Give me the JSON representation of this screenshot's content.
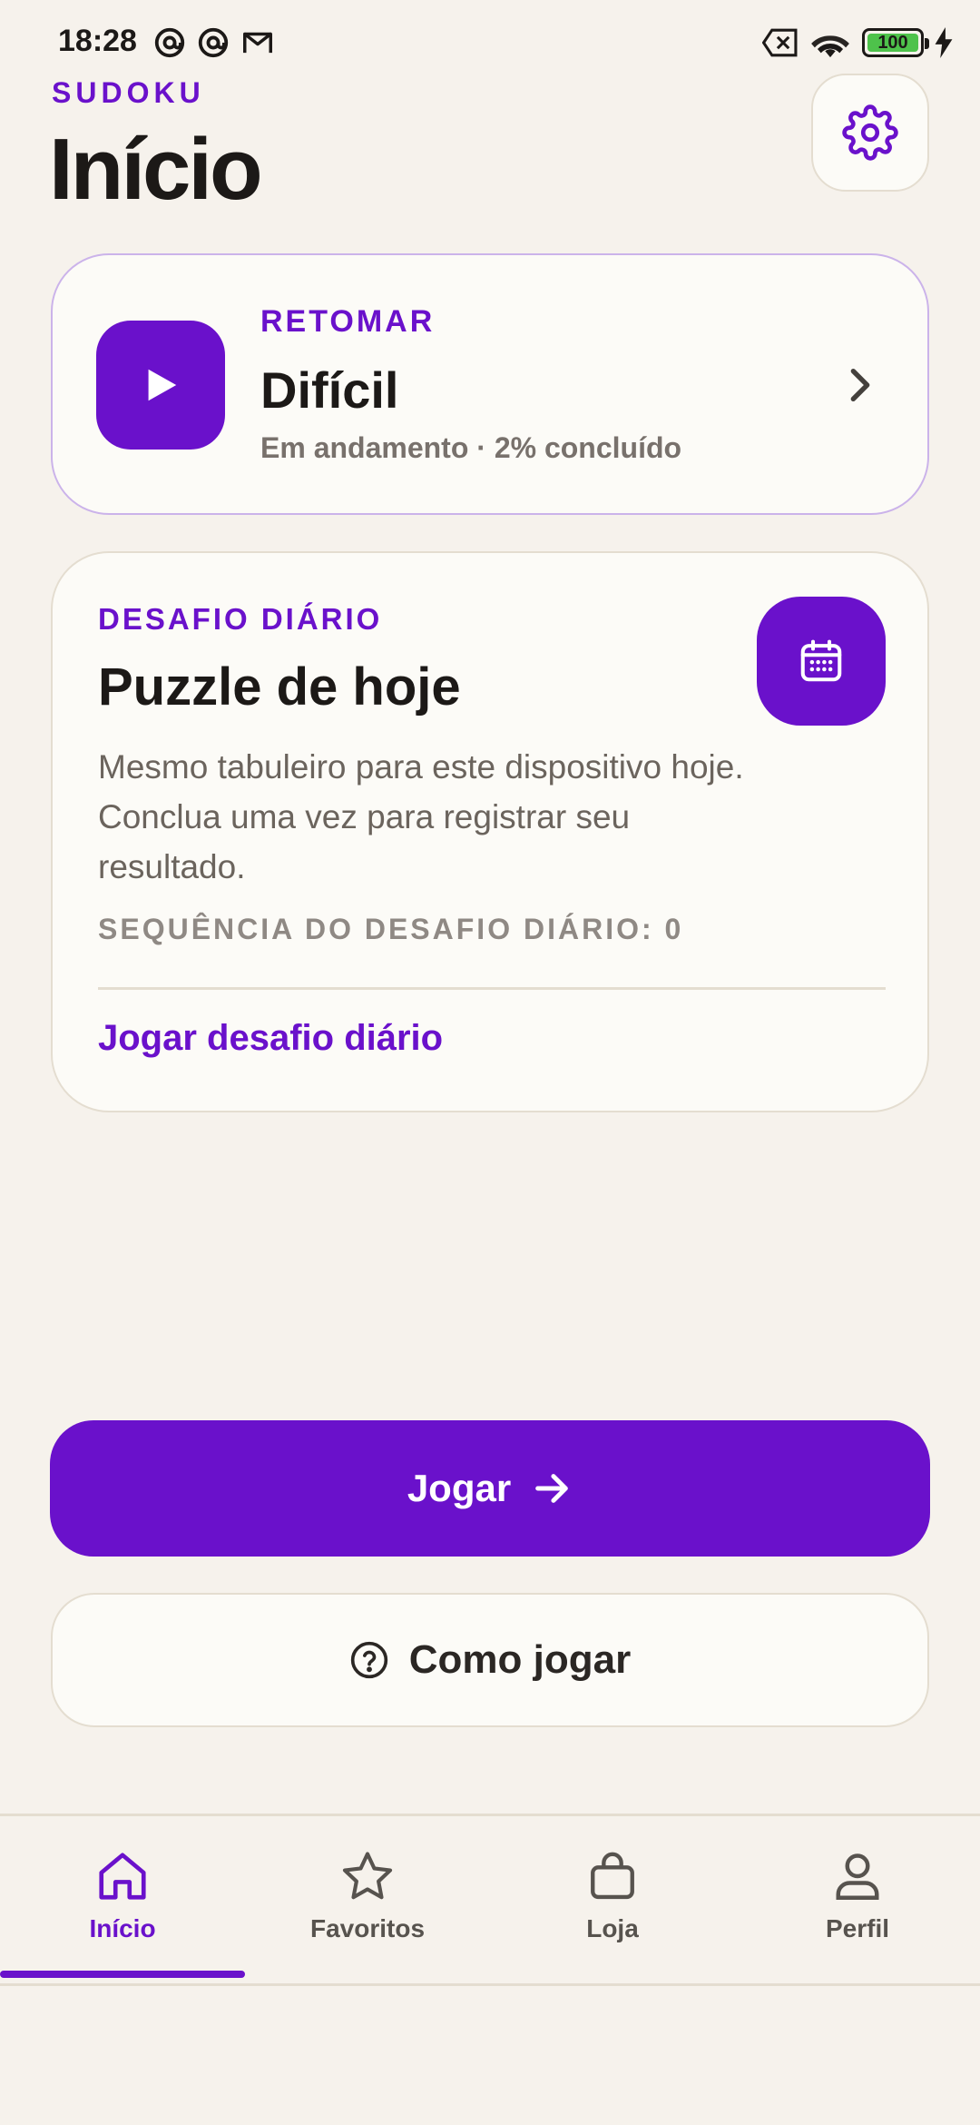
{
  "status_bar": {
    "time": "18:28",
    "left_icons": [
      "at-sign-icon",
      "at-sign-icon",
      "gmail-icon"
    ],
    "right_icons": [
      "no-sim-icon",
      "wifi-icon",
      "battery-icon",
      "charging-icon"
    ],
    "battery_level": "100",
    "battery_fraction": 1.0,
    "battery_color": "#4ec24b"
  },
  "header": {
    "eyebrow": "SUDOKU",
    "title": "Início",
    "settings_icon": "gear-icon"
  },
  "resume": {
    "eyebrow": "RETOMAR",
    "title": "Difícil",
    "subtitle": "Em andamento · 2% concluído",
    "progress_fraction": 0.02,
    "icon": "play-icon",
    "chevron_icon": "chevron-right-icon"
  },
  "daily": {
    "eyebrow": "DESAFIO DIÁRIO",
    "title": "Puzzle de hoje",
    "description": "Mesmo tabuleiro para este dispositivo hoje. Conclua uma vez para registrar seu resultado.",
    "streak": "SEQUÊNCIA DO DESAFIO DIÁRIO: 0",
    "link": "Jogar desafio diário",
    "icon": "calendar-icon"
  },
  "actions": {
    "play_label": "Jogar",
    "play_icon": "arrow-right-icon",
    "howto_label": "Como jogar",
    "howto_icon": "help-circle-icon"
  },
  "bottom_nav": {
    "active_index": 0,
    "items": [
      {
        "label": "Início",
        "icon": "home-icon"
      },
      {
        "label": "Favoritos",
        "icon": "star-icon"
      },
      {
        "label": "Loja",
        "icon": "shopping-bag-icon"
      },
      {
        "label": "Perfil",
        "icon": "user-icon"
      }
    ]
  },
  "colors": {
    "accent": "#6a11cb",
    "background": "#f6f2ec",
    "card": "#fcfbf7",
    "border": "#e4ddd0"
  }
}
